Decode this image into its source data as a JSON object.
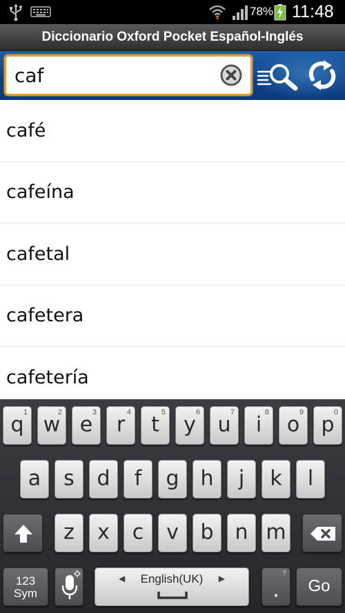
{
  "status_bar": {
    "battery_percent": "78%",
    "time": "11:48",
    "icons": [
      "usb-icon",
      "keyboard-icon",
      "wifi-icon",
      "signal-icon",
      "battery-charging-icon"
    ]
  },
  "app": {
    "title": "Diccionario Oxford Pocket Español-Inglés"
  },
  "search": {
    "value": "caf",
    "clear_icon": "clear-icon",
    "search_icon": "search-list-icon",
    "refresh_icon": "refresh-icon"
  },
  "results": [
    "café",
    "cafeína",
    "cafetal",
    "cafetera",
    "cafetería"
  ],
  "keyboard": {
    "row1": [
      {
        "label": "q",
        "hint": "1"
      },
      {
        "label": "w",
        "hint": "2"
      },
      {
        "label": "e",
        "hint": "3"
      },
      {
        "label": "r",
        "hint": "4"
      },
      {
        "label": "t",
        "hint": "5"
      },
      {
        "label": "y",
        "hint": "6"
      },
      {
        "label": "u",
        "hint": "7"
      },
      {
        "label": "i",
        "hint": "8"
      },
      {
        "label": "o",
        "hint": "9"
      },
      {
        "label": "p",
        "hint": "0"
      }
    ],
    "row2": [
      "a",
      "s",
      "d",
      "f",
      "g",
      "h",
      "j",
      "k",
      "l"
    ],
    "row3": [
      "z",
      "x",
      "c",
      "v",
      "b",
      "n",
      "m"
    ],
    "sym_label_1": "123",
    "sym_label_2": "Sym",
    "space_label": "English(UK)",
    "period_label": ".",
    "period_hint": "?",
    "go_label": "Go",
    "accent_colors": {
      "search_border": "#f09a20",
      "header_blue": "#0b3f86"
    }
  }
}
